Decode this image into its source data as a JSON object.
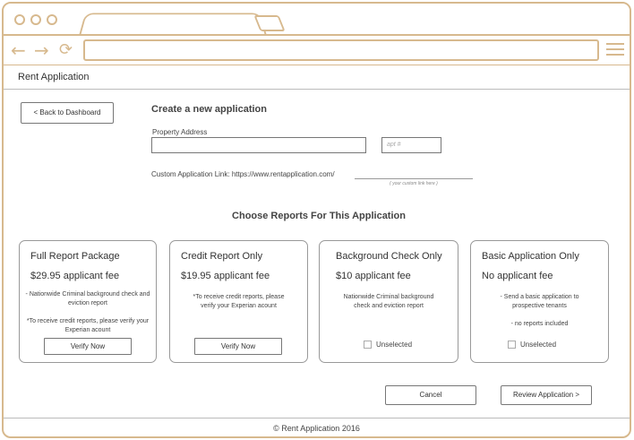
{
  "browser": {
    "window_dots": [
      "",
      "",
      ""
    ],
    "url": "",
    "accent_color": "#d7b98e"
  },
  "app": {
    "title": "Rent Application"
  },
  "nav": {
    "back_label": "< Back to Dashboard"
  },
  "form": {
    "section_title": "Create a new application",
    "address_label": "Property Address",
    "address_value": "",
    "apt_placeholder": "apt #",
    "custom_link_label": "Custom Application Link: https://www.rentapplication.com/",
    "custom_link_hint": "( your custom link here )"
  },
  "reports": {
    "heading": "Choose Reports For This Application",
    "cards": [
      {
        "title": "Full Report Package",
        "fee": "$29.95 applicant fee",
        "desc1": "- Nationwide Criminal background check and eviction report",
        "desc2": "*To receive credit reports, please verify your Experian acount",
        "action": "Verify Now"
      },
      {
        "title": "Credit Report Only",
        "fee": "$19.95 applicant fee",
        "desc1": "*To receive credit reports, please verify your Experian acount",
        "action": "Verify Now"
      },
      {
        "title": "Background Check Only",
        "fee": "$10 applicant fee",
        "desc1": "Nationwide Criminal background check and eviction report",
        "checkbox_label": "Unselected"
      },
      {
        "title": "Basic Application Only",
        "fee": "No applicant fee",
        "desc1": "- Send a basic application to prospective tenants",
        "desc2": "- no reports included",
        "checkbox_label": "Unselected"
      }
    ]
  },
  "actions": {
    "cancel": "Cancel",
    "review": "Review Application >"
  },
  "footer": {
    "text": "© Rent Application 2016"
  }
}
